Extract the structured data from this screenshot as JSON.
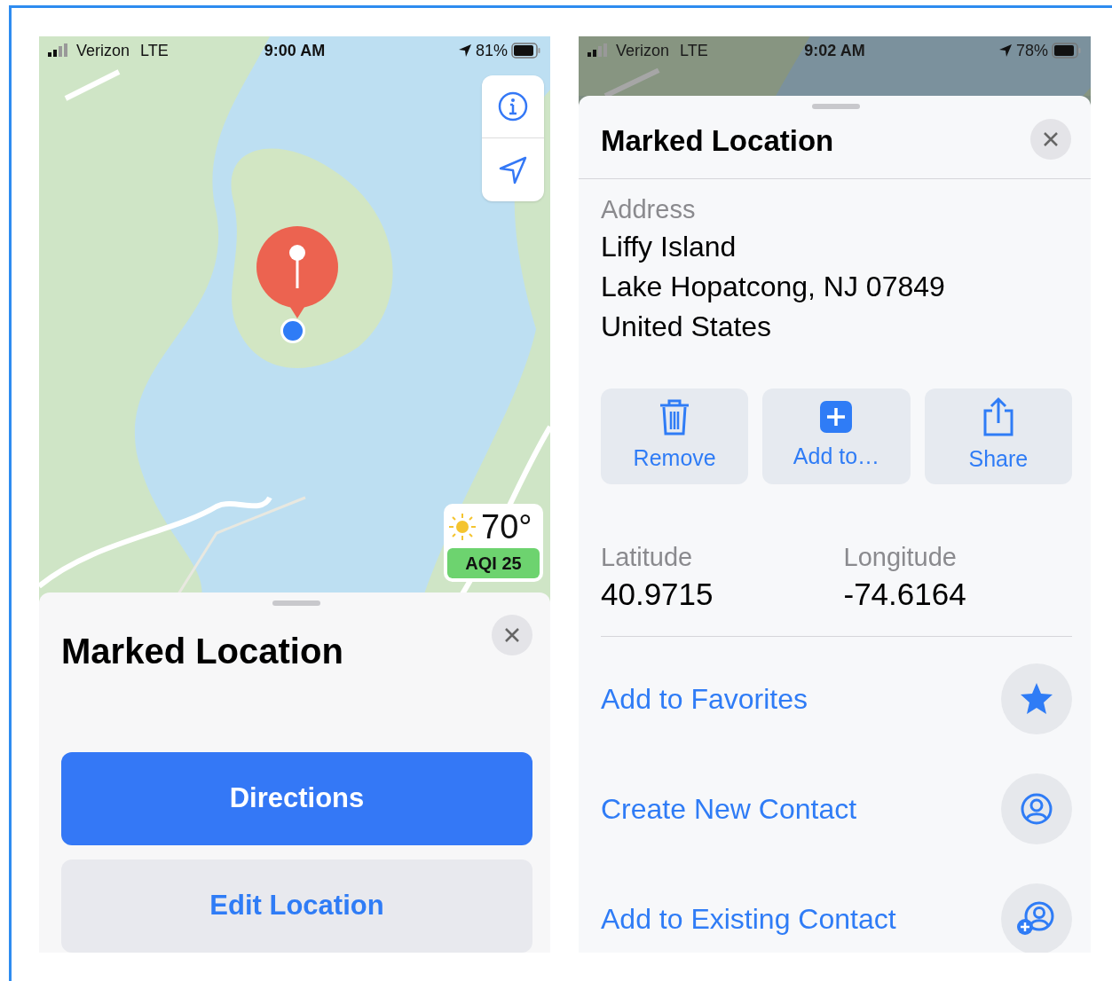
{
  "left_screen": {
    "status_bar": {
      "carrier": "Verizon",
      "network": "LTE",
      "time": "9:00 AM",
      "battery": "81%"
    },
    "weather": {
      "temperature": "70°",
      "aqi": "AQI 25"
    },
    "sheet": {
      "title": "Marked Location",
      "buttons": [
        {
          "label": "Directions",
          "kind": "primary"
        },
        {
          "label": "Edit Location",
          "kind": "secondary"
        }
      ]
    }
  },
  "right_screen": {
    "status_bar": {
      "carrier": "Verizon",
      "network": "LTE",
      "time": "9:02 AM",
      "battery": "78%"
    },
    "sheet": {
      "title": "Marked Location",
      "address_label": "Address",
      "address_lines": [
        "Liffy Island",
        "Lake Hopatcong, NJ  07849",
        "United States"
      ],
      "actions": [
        {
          "label": "Remove",
          "kind": "trash"
        },
        {
          "label": "Add to…",
          "kind": "add"
        },
        {
          "label": "Share",
          "kind": "share"
        }
      ],
      "coordinates": [
        {
          "label": "Latitude",
          "value": "40.9715"
        },
        {
          "label": "Longitude",
          "value": "-74.6164"
        }
      ],
      "list": [
        {
          "label": "Add to Favorites",
          "kind": "star"
        },
        {
          "label": "Create New Contact",
          "kind": "contact"
        },
        {
          "label": "Add to Existing Contact",
          "kind": "contact-add"
        }
      ]
    }
  }
}
